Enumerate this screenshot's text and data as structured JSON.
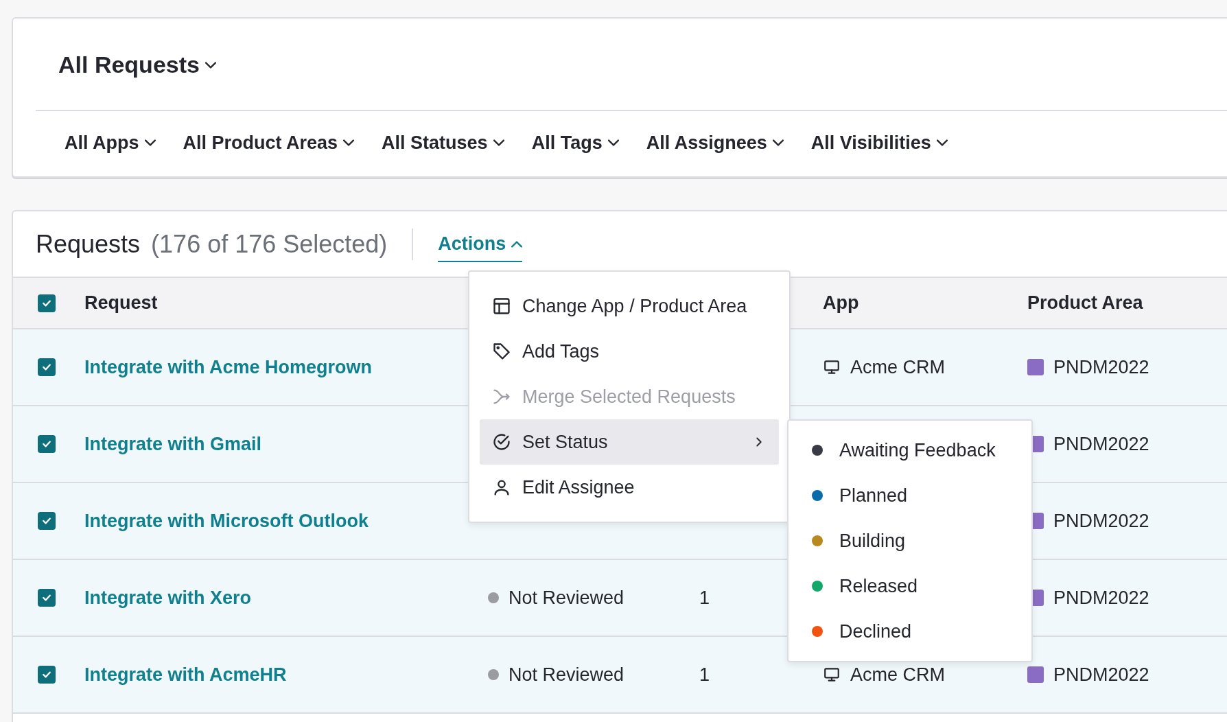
{
  "page_title": "All Requests",
  "filters": [
    "All Apps",
    "All Product Areas",
    "All Statuses",
    "All Tags",
    "All Assignees",
    "All Visibilities"
  ],
  "requests_panel": {
    "title": "Requests",
    "selection_count": "(176 of 176 Selected)",
    "actions_label": "Actions",
    "actions_expanded": true
  },
  "table": {
    "all_checked": true,
    "header": {
      "request": "Request",
      "app": "App",
      "product_area": "Product Area"
    },
    "rows": [
      {
        "checked": true,
        "request": "Integrate with Acme Homegrown",
        "app": "Acme CRM",
        "product_area": "PNDM2022"
      },
      {
        "checked": true,
        "request": "Integrate with Gmail",
        "product_area": "PNDM2022"
      },
      {
        "checked": true,
        "request": "Integrate with Microsoft Outlook",
        "product_area": "PNDM2022"
      },
      {
        "checked": true,
        "request": "Integrate with Xero",
        "status": "Not Reviewed",
        "count": "1",
        "product_area": "PNDM2022"
      },
      {
        "checked": true,
        "request": "Integrate with AcmeHR",
        "status": "Not Reviewed",
        "count": "1",
        "app": "Acme CRM",
        "product_area": "PNDM2022"
      }
    ]
  },
  "actions_menu": [
    {
      "label": "Change App / Product Area",
      "disabled": false,
      "selected": false,
      "has_submenu": false
    },
    {
      "label": "Add Tags",
      "disabled": false,
      "selected": false,
      "has_submenu": false
    },
    {
      "label": "Merge Selected Requests",
      "disabled": true,
      "selected": false,
      "has_submenu": false
    },
    {
      "label": "Set Status",
      "disabled": false,
      "selected": true,
      "has_submenu": true
    },
    {
      "label": "Edit Assignee",
      "disabled": false,
      "selected": false,
      "has_submenu": false
    }
  ],
  "status_submenu": [
    {
      "label": "Awaiting Feedback",
      "color": "#3a3b45"
    },
    {
      "label": "Planned",
      "color": "#0b6ba8"
    },
    {
      "label": "Building",
      "color": "#b8891c"
    },
    {
      "label": "Released",
      "color": "#11a86a"
    },
    {
      "label": "Declined",
      "color": "#f0540f"
    }
  ]
}
